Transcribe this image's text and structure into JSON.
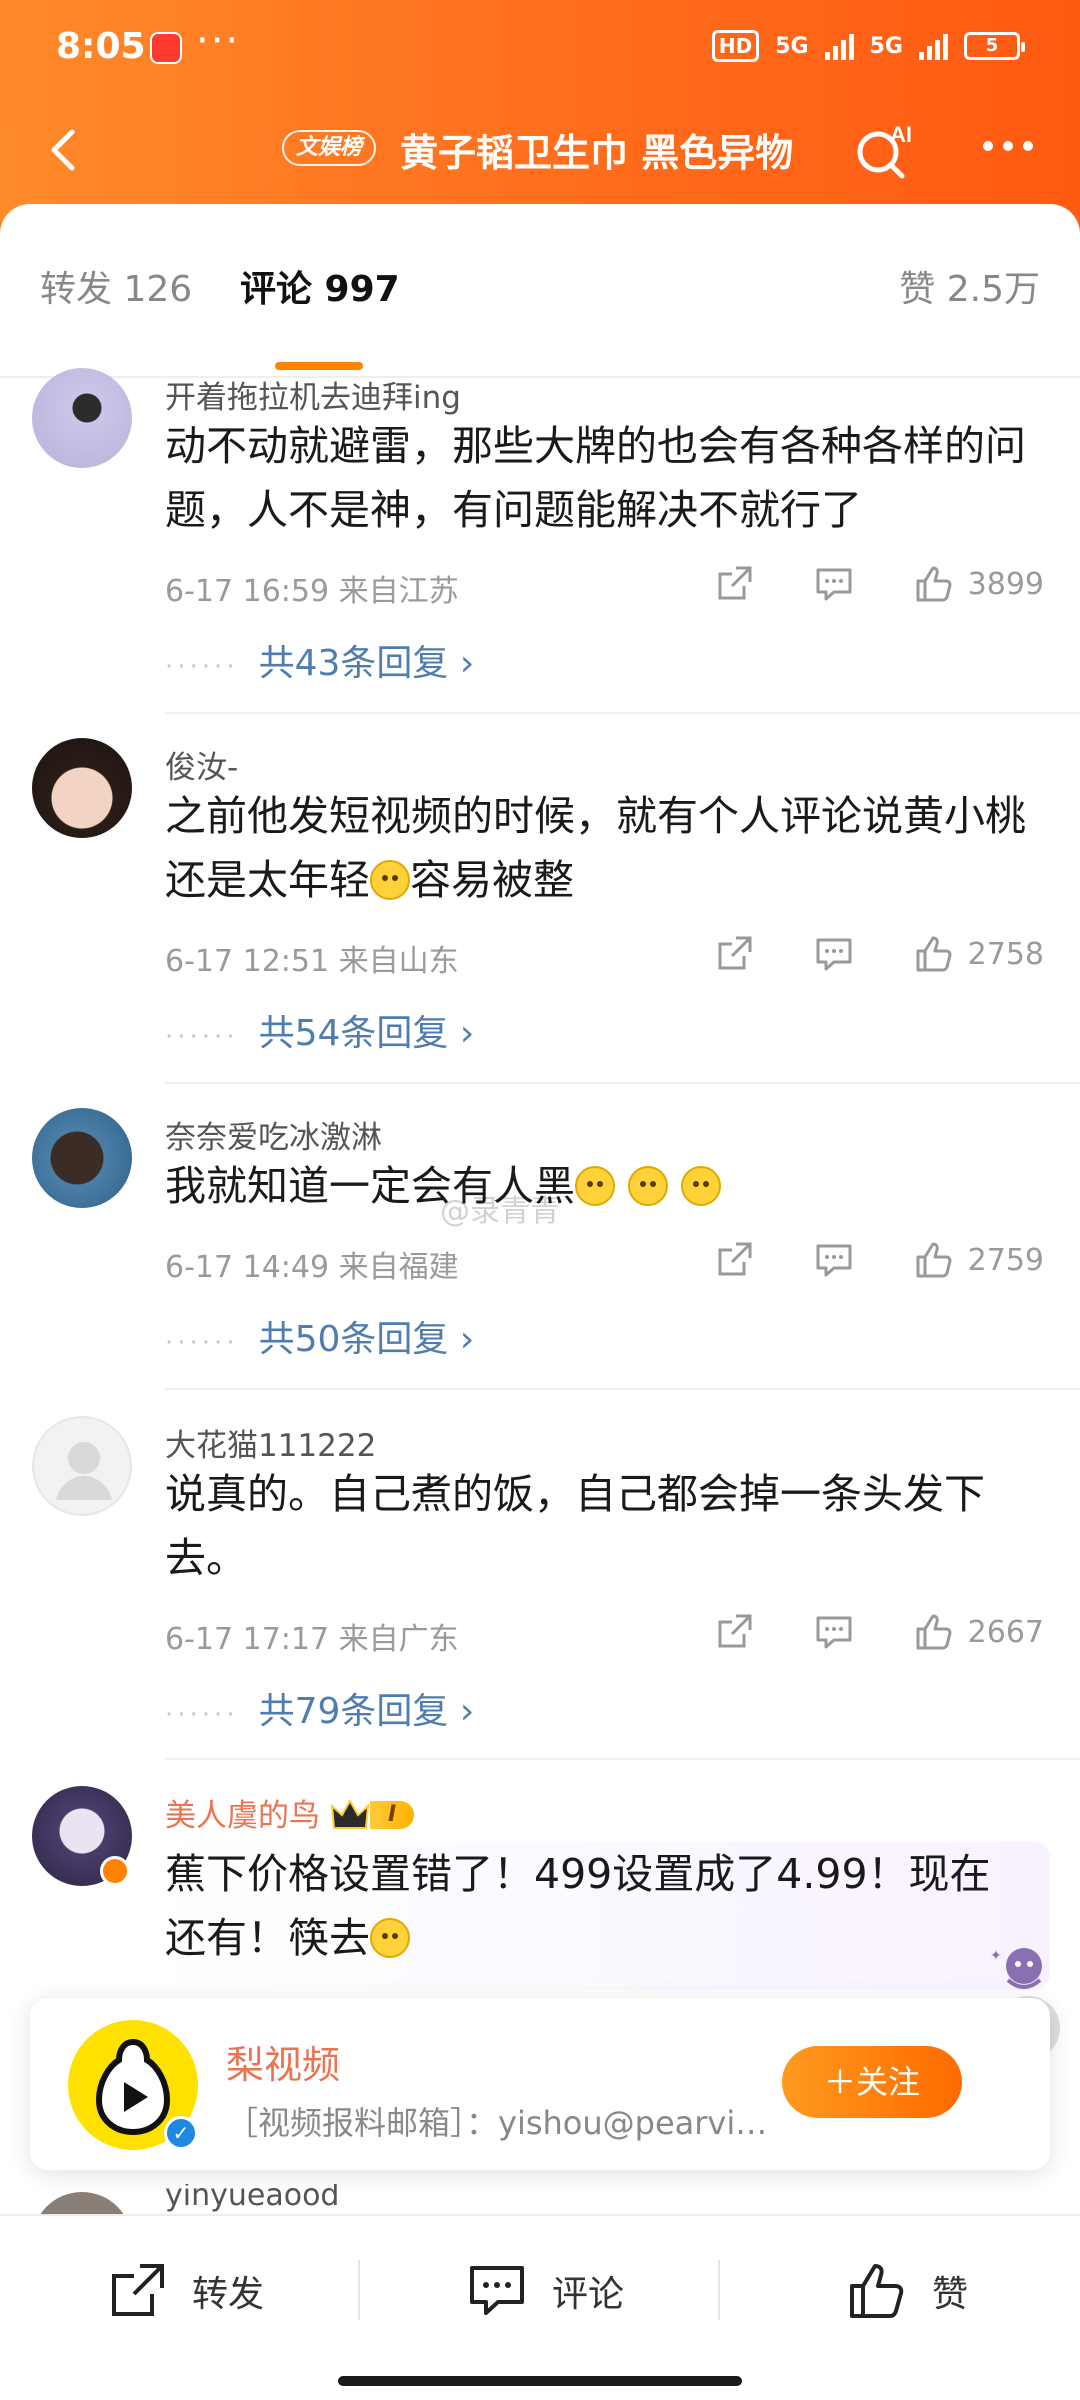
{
  "status_bar": {
    "time": "8:05",
    "dots": "···",
    "hd": "HD",
    "net1": "5G",
    "net2": "5G",
    "battery": "5"
  },
  "topbar": {
    "rank_badge": "文娱榜",
    "title": "黄子韬卫生巾 黑色异物",
    "ai_label": "AI"
  },
  "tabs": {
    "repost": "转发 126",
    "comments": "评论 997",
    "likes": "赞 2.5万"
  },
  "comments": [
    {
      "user": "开着拖拉机去迪拜ing",
      "text": "动不动就避雷，那些大牌的也会有各种各样的问题，人不是神，有问题能解决不就行了",
      "time": "6-17 16:59 来自江苏",
      "likes": "3899",
      "replies": "共43条回复 ›"
    },
    {
      "user": "俊汝-",
      "text_before": "之前他发短视频的时候，就有个人评论说黄小桃还是太年轻",
      "text_after": "容易被整",
      "time": "6-17 12:51 来自山东",
      "likes": "2758",
      "replies": "共54条回复 ›"
    },
    {
      "user": "奈奈爱吃冰激淋",
      "text": "我就知道一定会有人黑",
      "time": "6-17 14:49 来自福建",
      "likes": "2759",
      "replies": "共50条回复 ›"
    },
    {
      "user": "大花猫111222",
      "text": "说真的。自己煮的饭，自己都会掉一条头发下去。",
      "time": "6-17 17:17 来自广东",
      "likes": "2667",
      "replies": "共79条回复 ›"
    },
    {
      "user": "美人虞的鸟",
      "vip_level": "I",
      "text_before": "蕉下价格设置错了！499设置成了4.99！现在还有！筷去",
      "text_after": ""
    }
  ],
  "watermark": "@录青青",
  "follow_card": {
    "name": "梨视频",
    "desc": "［视频报料邮箱］：yishou@pearvideo.com",
    "button": "＋关注"
  },
  "peek_user": "yinyueaood",
  "bottom_bar": {
    "repost": "转发",
    "comment": "评论",
    "like": "赞"
  },
  "colors": {
    "header_orange": "#ff6a1a",
    "accent": "#ff8200",
    "link_blue": "#507daf",
    "vip_name": "#eb7350"
  }
}
